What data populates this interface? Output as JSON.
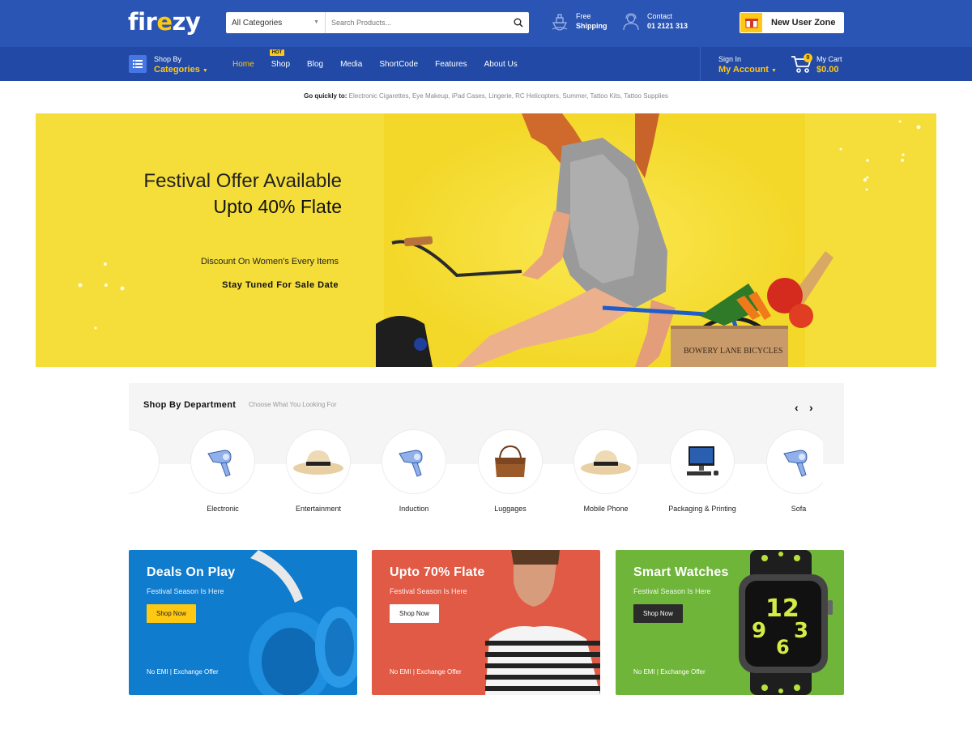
{
  "brand": {
    "logo_a": "fir",
    "logo_b": "e",
    "logo_c": "zy"
  },
  "search": {
    "category": "All Categories",
    "placeholder": "Search Products..."
  },
  "header_info": {
    "shipping_line1": "Free",
    "shipping_line2": "Shipping",
    "contact_line1": "Contact",
    "contact_line2": "01 2121 313"
  },
  "new_user": {
    "label": "New User Zone"
  },
  "nav": {
    "shop_by": "Shop By",
    "categories": "Categories",
    "items": [
      {
        "label": "Home",
        "active": true
      },
      {
        "label": "Shop",
        "badge": "HOT"
      },
      {
        "label": "Blog"
      },
      {
        "label": "Media"
      },
      {
        "label": "ShortCode"
      },
      {
        "label": "Features"
      },
      {
        "label": "About Us"
      }
    ],
    "sign_in": "Sign In",
    "my_account": "My Account",
    "cart_label": "My Cart",
    "cart_total": "$0.00",
    "cart_count": "0"
  },
  "quick_links": {
    "label": "Go quickly to:",
    "links": [
      "Electronic Cigarettes",
      "Eye Makeup",
      "iPad Cases",
      "Lingerie",
      "RC Helicopters",
      "Summer",
      "Tattoo Kits",
      "Tattoo Supplies"
    ]
  },
  "hero": {
    "line1": "Festival Offer Available",
    "line2": "Upto 40% Flate",
    "line3": "Discount On Women's Every Items",
    "line4": "Stay Tuned For Sale Date",
    "crate_text": "BOWERY LANE BICYCLES"
  },
  "department": {
    "title": "Shop By Department",
    "subtitle": "Choose What You Looking For",
    "items": [
      {
        "label": "Electronic",
        "icon": "hair-dryer-icon"
      },
      {
        "label": "Entertainment",
        "icon": "sun-hat-icon"
      },
      {
        "label": "Induction",
        "icon": "hair-dryer-icon"
      },
      {
        "label": "Luggages",
        "icon": "leather-bag-icon"
      },
      {
        "label": "Mobile Phone",
        "icon": "sun-hat-icon"
      },
      {
        "label": "Packaging & Printing",
        "icon": "desktop-computer-icon"
      },
      {
        "label": "Sofa",
        "icon": "hair-dryer-icon"
      }
    ]
  },
  "promos": [
    {
      "title": "Deals On Play",
      "subtitle": "Festival Season Is Here",
      "button": "Shop Now",
      "footer": "No EMI | Exchange Offer",
      "color": "#0f7ccd"
    },
    {
      "title": "Upto 70% Flate",
      "subtitle": "Festival Season Is Here",
      "button": "Shop Now",
      "footer": "No EMI | Exchange Offer",
      "color": "#e15a45"
    },
    {
      "title": "Smart Watches",
      "subtitle": "Festival Season Is Here",
      "button": "Shop Now",
      "footer": "No EMI | Exchange Offer",
      "color": "#6fb53a"
    }
  ],
  "colors": {
    "primary": "#2b55b4",
    "nav": "#2149a5",
    "accent": "#ffc812",
    "hero_bg": "#f5de3a"
  }
}
